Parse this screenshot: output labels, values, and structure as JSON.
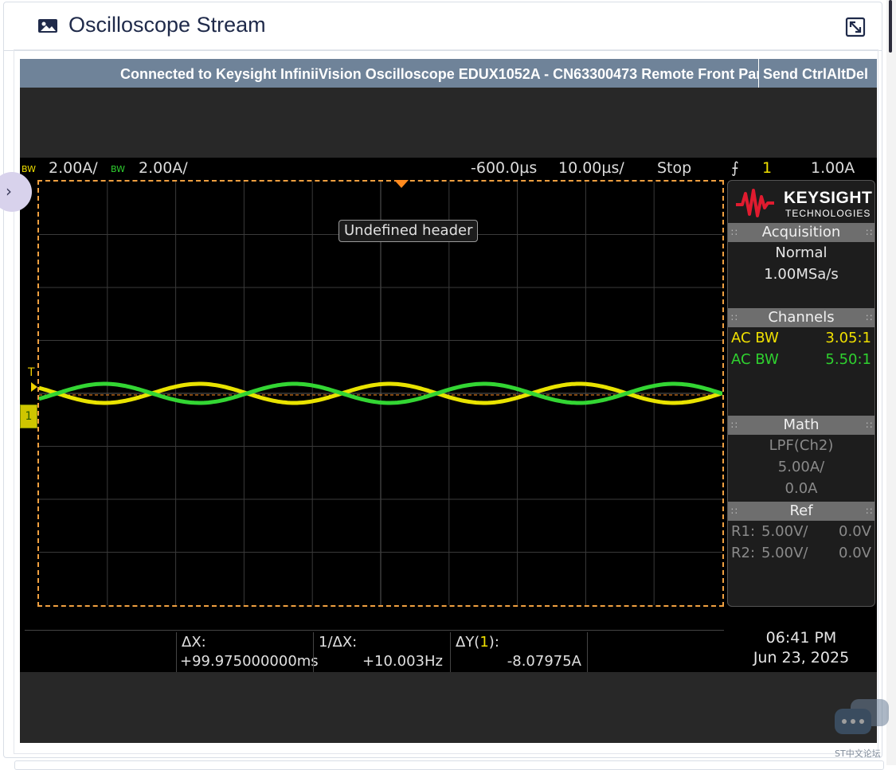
{
  "card": {
    "title": "Oscilloscope Stream",
    "title_icon": "image-icon",
    "expand_icon": "expand-icon"
  },
  "connection": {
    "text": "Connected to Keysight InfiniiVision Oscilloscope EDUX1052A - CN63300473 Remote Front Panel",
    "ctrl_button": "Send CtrlAltDel"
  },
  "status": {
    "ch1_bw": "BW",
    "ch1_scale": "2.00A/",
    "ch2_bw": "BW",
    "ch2_scale": "2.00A/",
    "delay": "-600.0µs",
    "timebase": "10.00µs/",
    "run_state": "Stop",
    "trigger_source": "1",
    "trigger_level": "1.00A"
  },
  "overlay": {
    "header_tooltip": "Undefined header",
    "trigger_tag": "T",
    "channel_tag": "1"
  },
  "panel": {
    "brand": "KEYSIGHT",
    "brand_sub": "TECHNOLOGIES",
    "acquisition": {
      "title": "Acquisition",
      "mode": "Normal",
      "rate": "1.00MSa/s"
    },
    "channels": {
      "title": "Channels",
      "rows": [
        {
          "label": "AC BW",
          "value": "3.05:1",
          "color": "#f0e000"
        },
        {
          "label": "AC BW",
          "value": "5.50:1",
          "color": "#2fd12f"
        }
      ]
    },
    "math": {
      "title": "Math",
      "func": "LPF(Ch2)",
      "scale": "5.00A/",
      "offset": "0.0A"
    },
    "ref": {
      "title": "Ref",
      "rows": [
        {
          "label": "R1:",
          "scale": "5.00V/",
          "offset": "0.0V"
        },
        {
          "label": "R2:",
          "scale": "5.00V/",
          "offset": "0.0V"
        }
      ]
    }
  },
  "measurements": {
    "dx_label": "ΔX:",
    "dx_value": "+99.975000000ms",
    "inv_dx_label": "1/ΔX:",
    "inv_dx_value": "+10.003Hz",
    "dy_label_pre": "ΔY(",
    "dy_label_ch": "1",
    "dy_label_post": "):",
    "dy_value": "-8.07975A"
  },
  "clock": {
    "time": "06:41 PM",
    "date": "Jun 23, 2025"
  },
  "watermark": "ST中文论坛",
  "colors": {
    "ch1": "#f0e000",
    "ch2": "#2fd12f",
    "grid_border": "#f0a040",
    "connection_bar": "#6f8399"
  },
  "waveforms": {
    "ch1_color": "#e9e300",
    "ch2_color": "#33d633",
    "cycles_visible": 3.6
  }
}
